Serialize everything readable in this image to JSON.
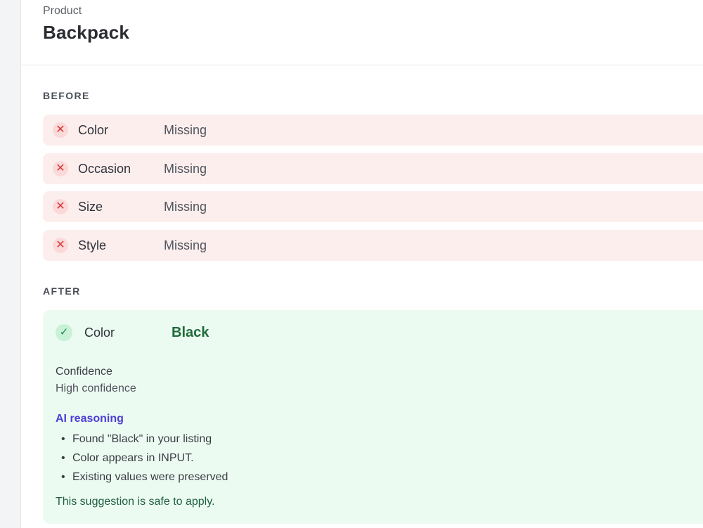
{
  "product": {
    "kicker": "Product",
    "name": "Backpack"
  },
  "before": {
    "label": "BEFORE",
    "rows": [
      {
        "attribute": "Color",
        "value": "Missing",
        "icon": "x-icon"
      },
      {
        "attribute": "Occasion",
        "value": "Missing",
        "icon": "x-icon"
      },
      {
        "attribute": "Size",
        "value": "Missing",
        "icon": "x-icon"
      },
      {
        "attribute": "Style",
        "value": "Missing",
        "icon": "x-icon"
      }
    ]
  },
  "after": {
    "label": "AFTER",
    "attribute": "Color",
    "value": "Black",
    "icon": "check-icon",
    "confidence_label": "Confidence",
    "confidence_value": "High confidence",
    "reasoning_label": "AI reasoning",
    "reasons": [
      "Found \"Black\" in your listing",
      "Color appears in INPUT.",
      "Existing values were preserved"
    ],
    "safe_text": "This suggestion is safe to apply."
  },
  "colors": {
    "error_bg": "#fdeeee",
    "error_icon": "#d9383a",
    "success_bg": "#ecfbf2",
    "success_value": "#1f6b39",
    "reasoning_accent": "#4b3fd6"
  }
}
